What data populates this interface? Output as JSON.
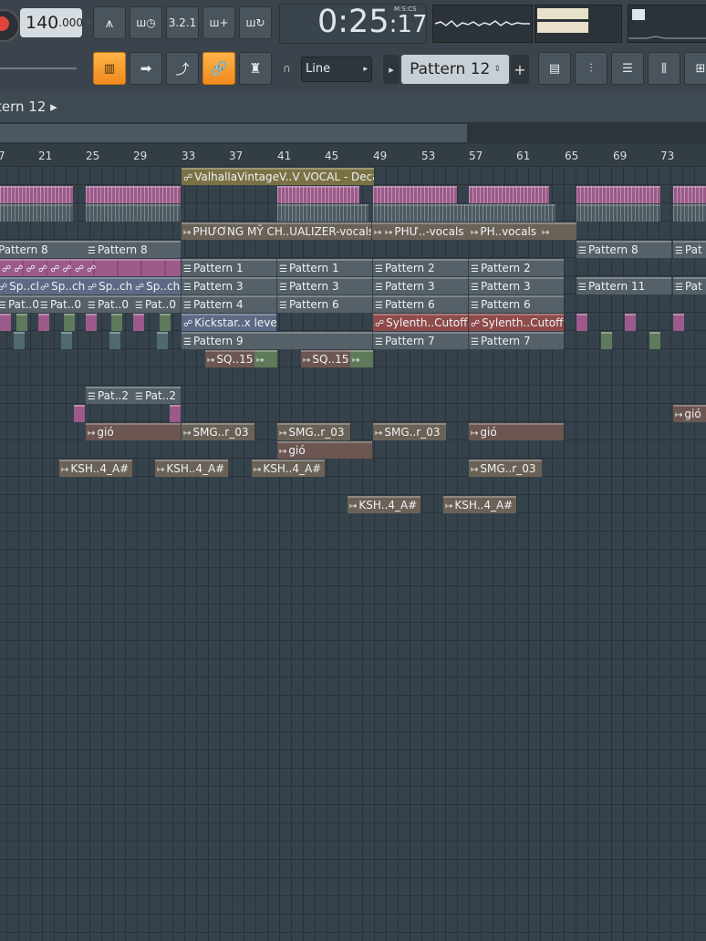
{
  "toolbar": {
    "tempo_main": "140",
    "tempo_fraction": ".000",
    "song_time": "0:25",
    "song_time_cs": ":17",
    "time_units": "M:S:CS",
    "snap_mode": "Line",
    "current_pattern": "Pattern 12",
    "add_pattern": "+",
    "buttons": [
      "metronome-button",
      "wait-for-input-button",
      "countdown-button",
      "step-edit-button",
      "loop-record-button"
    ]
  },
  "view": {
    "title": "tern 12 ▸"
  },
  "ruler": [
    "7",
    "21",
    "25",
    "29",
    "33",
    "37",
    "41",
    "45",
    "49",
    "53",
    "57",
    "61",
    "65",
    "69",
    "73"
  ],
  "clips": [
    {
      "label": "ValhallaVintageV..V VOCAL  - Decay",
      "type": "auto"
    },
    {
      "label": "PHƯƠNG MỸ CH..UALIZER-vocals",
      "type": "audio"
    },
    {
      "label": "PHƯ..-vocals",
      "type": "audio"
    },
    {
      "label": "PH..vocals",
      "type": "audio"
    },
    {
      "label": "Pattern 8",
      "type": "pattern"
    },
    {
      "label": "Pattern 8",
      "type": "pattern"
    },
    {
      "label": "Pattern 8",
      "type": "pattern"
    },
    {
      "label": "Pat",
      "type": "pattern"
    },
    {
      "label": "Pattern 1",
      "type": "pattern"
    },
    {
      "label": "Pattern 1",
      "type": "pattern"
    },
    {
      "label": "Pattern 2",
      "type": "pattern"
    },
    {
      "label": "Pattern 2",
      "type": "pattern"
    },
    {
      "label": "Sp..ch",
      "type": "auto"
    },
    {
      "label": "Sp..ch",
      "type": "auto"
    },
    {
      "label": "Sp..ch",
      "type": "auto"
    },
    {
      "label": "Sp..ch",
      "type": "auto"
    },
    {
      "label": "Pattern 3",
      "type": "pattern"
    },
    {
      "label": "Pattern 3",
      "type": "pattern"
    },
    {
      "label": "Pattern 3",
      "type": "pattern"
    },
    {
      "label": "Pattern 3",
      "type": "pattern"
    },
    {
      "label": "Pattern 11",
      "type": "pattern"
    },
    {
      "label": "Pat",
      "type": "pattern"
    },
    {
      "label": "Pat..0",
      "type": "pattern"
    },
    {
      "label": "Pat..0",
      "type": "pattern"
    },
    {
      "label": "Pat..0",
      "type": "pattern"
    },
    {
      "label": "Pat..0",
      "type": "pattern"
    },
    {
      "label": "Pattern 4",
      "type": "pattern"
    },
    {
      "label": "Pattern 6",
      "type": "pattern"
    },
    {
      "label": "Pattern 6",
      "type": "pattern"
    },
    {
      "label": "Pattern 6",
      "type": "pattern"
    },
    {
      "label": "Kickstar..x level",
      "type": "auto"
    },
    {
      "label": "Sylenth..Cutoff",
      "type": "auto"
    },
    {
      "label": "Sylenth..Cutoff",
      "type": "auto"
    },
    {
      "label": "Pattern 9",
      "type": "pattern"
    },
    {
      "label": "Pattern 7",
      "type": "pattern"
    },
    {
      "label": "Pattern 7",
      "type": "pattern"
    },
    {
      "label": "SQ..15",
      "type": "audio"
    },
    {
      "label": "SQ..15",
      "type": "audio"
    },
    {
      "label": "Pat..2",
      "type": "pattern"
    },
    {
      "label": "Pat..2",
      "type": "pattern"
    },
    {
      "label": "gió",
      "type": "audio"
    },
    {
      "label": "gió",
      "type": "audio"
    },
    {
      "label": "SMG..r_03",
      "type": "audio"
    },
    {
      "label": "SMG..r_03",
      "type": "audio"
    },
    {
      "label": "SMG..r_03",
      "type": "audio"
    },
    {
      "label": "gió",
      "type": "audio"
    },
    {
      "label": "gió",
      "type": "audio"
    },
    {
      "label": "KSH..4_A#",
      "type": "audio"
    },
    {
      "label": "KSH..4_A#",
      "type": "audio"
    },
    {
      "label": "KSH..4_A#",
      "type": "audio"
    },
    {
      "label": "SMG..r_03",
      "type": "audio"
    },
    {
      "label": "KSH..4_A#",
      "type": "audio"
    },
    {
      "label": "KSH..4_A#",
      "type": "audio"
    }
  ]
}
